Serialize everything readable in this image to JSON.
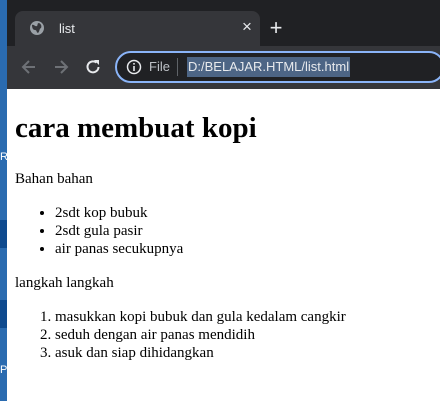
{
  "tab": {
    "title": "list",
    "close_glyph": "×",
    "icon": "globe-icon"
  },
  "new_tab_glyph": "+",
  "toolbar": {
    "scheme_label": "File",
    "url": "D:/BELAJAR.HTML/list.html",
    "back_icon": "arrow-left-icon",
    "forward_icon": "arrow-right-icon",
    "reload_icon": "reload-icon",
    "info_icon": "info-icon"
  },
  "page": {
    "heading": "cara membuat kopi",
    "ingredients_label": "Bahan bahan",
    "ingredients": [
      "2sdt kop bubuk",
      "2sdt gula pasir",
      "air panas secukupnya"
    ],
    "steps_label": "langkah langkah",
    "steps": [
      "masukkan kopi bubuk dan gula kedalam cangkir",
      "seduh dengan air panas mendidih",
      "asuk dan siap dihidangkan"
    ]
  },
  "desktop": {
    "fragment_top": "Re",
    "fragment_bottom": "P"
  },
  "colors": {
    "tabstrip": "#202124",
    "toolbar": "#35363a",
    "omnibox_border": "#8ab4f8",
    "url_selection": "#4d6585",
    "desktop": "#1e4f86"
  }
}
